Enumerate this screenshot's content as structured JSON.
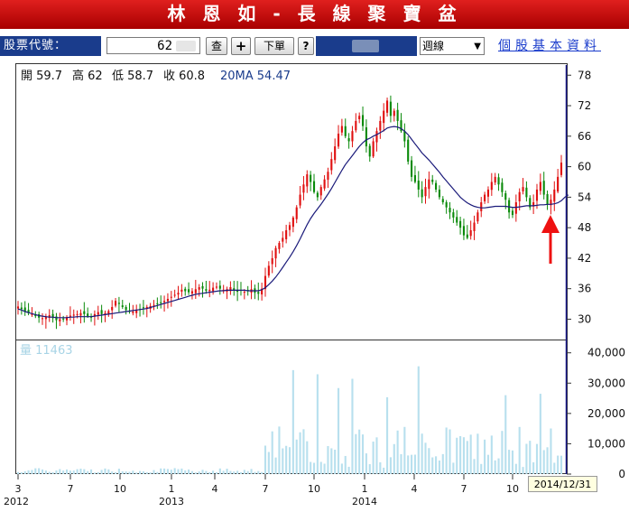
{
  "header": {
    "title": "林 恩 如 - 長 線 聚 寶 盆"
  },
  "toolbar": {
    "code_label": "股票代號：",
    "code_value": "62",
    "query_button": "查",
    "add_button": "+",
    "next_button": "下單",
    "help_button": "?",
    "period_select": "週線",
    "profile_link": "個股基本資料"
  },
  "chart_data": [
    {
      "type": "candlestick",
      "info": {
        "open": "開 59.7",
        "high": "高 62",
        "low": "低 58.7",
        "close": "收 60.8",
        "ma": "20MA 54.47"
      },
      "y_ticks": [
        30,
        36,
        42,
        48,
        54,
        60,
        66,
        72,
        78
      ],
      "ylim": [
        26,
        80
      ],
      "x_ticks": [
        "3",
        "7",
        "10",
        "1",
        "4",
        "7",
        "10",
        "1",
        "4",
        "7",
        "10"
      ],
      "year_labels": [
        "2012",
        "2013",
        "2014"
      ],
      "close": [
        32.5,
        32.0,
        31.6,
        31.2,
        31.0,
        30.6,
        30.3,
        30.2,
        30.5,
        30.8,
        30.2,
        29.8,
        30.0,
        30.1,
        30.4,
        30.7,
        30.9,
        31.0,
        31.2,
        31.0,
        30.6,
        30.4,
        31.0,
        31.4,
        31.0,
        31.2,
        31.6,
        32.4,
        33.6,
        33.0,
        32.4,
        31.8,
        31.6,
        31.5,
        31.8,
        32.0,
        32.2,
        32.4,
        32.6,
        32.8,
        33.0,
        33.2,
        33.6,
        34.0,
        34.4,
        34.8,
        35.2,
        35.8,
        35.5,
        35.3,
        35.5,
        35.9,
        36.3,
        36.0,
        35.6,
        35.8,
        36.2,
        36.4,
        36.0,
        35.8,
        35.9,
        36.3,
        35.7,
        35.4,
        35.6,
        35.4,
        35.5,
        35.9,
        35.2,
        35.0,
        36.0,
        38.5,
        40.5,
        42.0,
        44.0,
        45.0,
        46.0,
        47.5,
        48.5,
        50.0,
        52.0,
        54.5,
        56.5,
        58.5,
        57.0,
        55.0,
        54.0,
        56.0,
        57.5,
        59.0,
        61.5,
        64.0,
        66.5,
        68.0,
        66.0,
        65.0,
        67.0,
        69.0,
        70.0,
        68.0,
        64.0,
        62.0,
        65.0,
        67.0,
        69.0,
        71.0,
        73.0,
        70.0,
        71.0,
        69.0,
        67.0,
        65.0,
        61.0,
        58.0,
        57.0,
        55.5,
        54.0,
        56.0,
        57.5,
        57.0,
        55.5,
        54.0,
        53.0,
        52.0,
        51.0,
        50.0,
        49.0,
        48.0,
        46.5,
        46.0,
        47.5,
        49.0,
        51.0,
        53.0,
        54.5,
        55.5,
        57.0,
        58.0,
        56.5,
        55.0,
        53.5,
        51.0,
        50.5,
        53.0,
        55.0,
        56.0,
        54.0,
        52.0,
        53.0,
        55.5,
        57.0,
        54.5,
        52.5,
        53.5,
        55.5,
        58.0,
        60.8
      ],
      "ma20": [
        32.0,
        31.8,
        31.5,
        31.3,
        31.1,
        30.9,
        30.7,
        30.6,
        30.5,
        30.4,
        30.4,
        30.3,
        30.3,
        30.3,
        30.3,
        30.4,
        30.4,
        30.5,
        30.5,
        30.5,
        30.5,
        30.5,
        30.6,
        30.7,
        30.8,
        30.9,
        31.0,
        31.1,
        31.2,
        31.3,
        31.4,
        31.5,
        31.6,
        31.7,
        31.8,
        31.9,
        32.0,
        32.1,
        32.3,
        32.5,
        32.7,
        32.9,
        33.1,
        33.3,
        33.5,
        33.7,
        33.9,
        34.1,
        34.3,
        34.5,
        34.7,
        34.9,
        35.0,
        35.1,
        35.2,
        35.3,
        35.4,
        35.5,
        35.6,
        35.6,
        35.7,
        35.7,
        35.7,
        35.7,
        35.7,
        35.7,
        35.6,
        35.6,
        35.6,
        35.6,
        35.8,
        36.2,
        36.8,
        37.5,
        38.3,
        39.2,
        40.2,
        41.2,
        42.2,
        43.3,
        44.5,
        45.8,
        47.2,
        48.6,
        49.8,
        50.8,
        51.7,
        52.6,
        53.6,
        54.6,
        55.7,
        56.9,
        58.1,
        59.3,
        60.4,
        61.3,
        62.2,
        63.1,
        64.0,
        64.7,
        65.3,
        65.6,
        66.0,
        66.3,
        66.7,
        67.1,
        67.6,
        67.8,
        67.9,
        67.8,
        67.5,
        67.0,
        66.3,
        65.4,
        64.5,
        63.6,
        62.7,
        62.0,
        61.3,
        60.5,
        59.7,
        58.9,
        58.0,
        57.2,
        56.4,
        55.6,
        54.8,
        54.0,
        53.4,
        52.9,
        52.5,
        52.2,
        52.0,
        51.9,
        51.9,
        52.0,
        52.1,
        52.2,
        52.2,
        52.2,
        52.2,
        52.1,
        52.0,
        52.0,
        52.1,
        52.2,
        52.3,
        52.3,
        52.3,
        52.4,
        52.5,
        52.5,
        52.6,
        52.6,
        52.7,
        52.9,
        53.3,
        54.0,
        54.47
      ],
      "volume_label": "量 11463",
      "volume_ticks": [
        "0",
        "10,000",
        "20,000",
        "30,000",
        "40,000"
      ],
      "volume_max": 42000
    }
  ],
  "footer": {
    "date_badge": "2014/12/31"
  }
}
